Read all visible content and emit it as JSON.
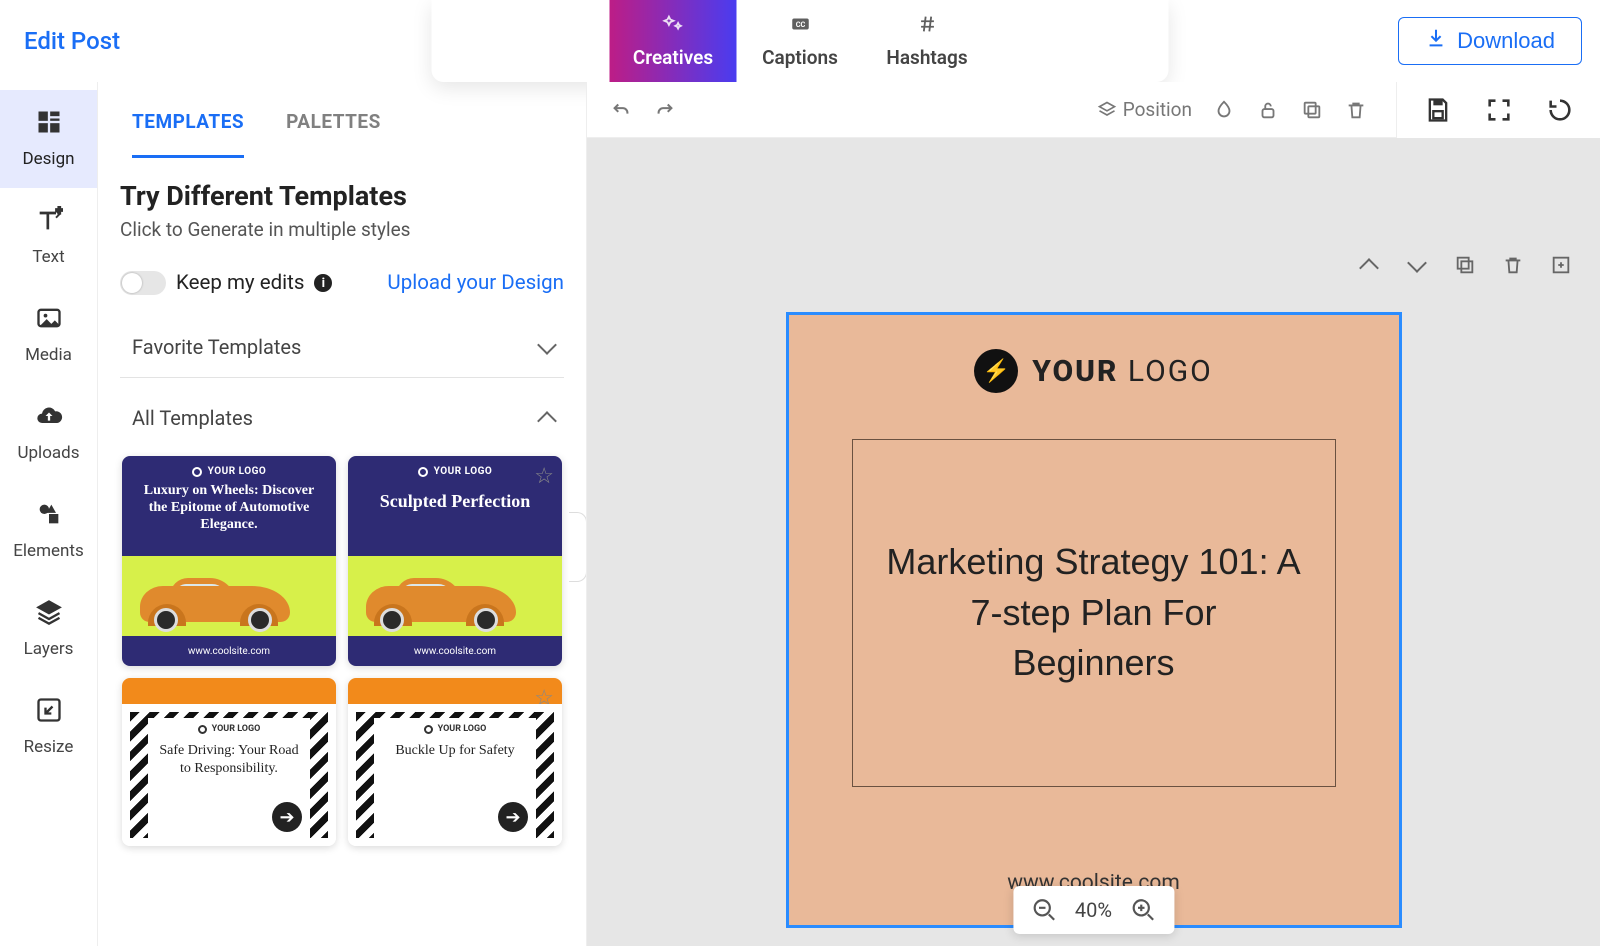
{
  "header": {
    "edit_post": "Edit Post",
    "tabs": {
      "creatives": "Creatives",
      "captions": "Captions",
      "hashtags": "Hashtags"
    },
    "download": "Download"
  },
  "rail": {
    "design": "Design",
    "text": "Text",
    "media": "Media",
    "uploads": "Uploads",
    "elements": "Elements",
    "layers": "Layers",
    "resize": "Resize"
  },
  "panel": {
    "tabs": {
      "templates": "TEMPLATES",
      "palettes": "PALETTES"
    },
    "title": "Try Different Templates",
    "subtitle": "Click to Generate in multiple styles",
    "keep_edits": "Keep my edits",
    "upload_design": "Upload your Design",
    "favorite_templates": "Favorite Templates",
    "all_templates": "All Templates",
    "tpl1": {
      "logo": "YOUR LOGO",
      "headline": "Luxury on Wheels: Discover the Epitome of Automotive Elegance.",
      "site": "www.coolsite.com"
    },
    "tpl2": {
      "logo": "YOUR LOGO",
      "headline": "Sculpted Perfection",
      "site": "www.coolsite.com"
    },
    "tpl3": {
      "logo": "YOUR LOGO",
      "headline": "Safe Driving: Your Road to Responsibility."
    },
    "tpl4": {
      "logo": "YOUR LOGO",
      "headline": "Buckle Up for Safety"
    }
  },
  "canvas": {
    "toolbar": {
      "position": "Position"
    },
    "zoom": "40%",
    "design": {
      "logo_bold": "YOUR",
      "logo_rest": " LOGO",
      "title": "Marketing Strategy 101: A 7-step Plan For Beginners",
      "site": "www.coolsite.com"
    }
  }
}
